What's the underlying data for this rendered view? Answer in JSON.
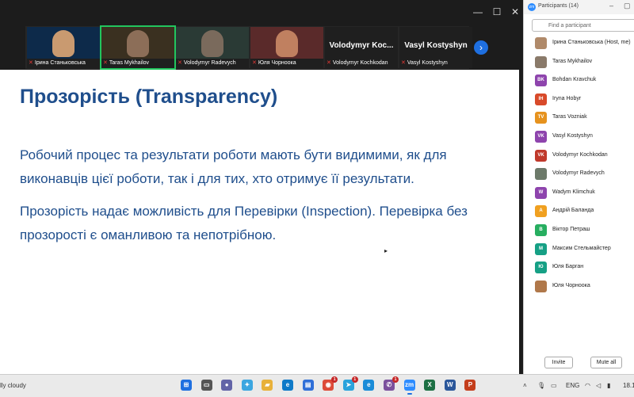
{
  "window": {
    "minimize_icon": "minimize-icon",
    "maximize_icon": "maximize-icon",
    "close_icon": "close-icon",
    "minimize_glyph": "—",
    "maximize_glyph": "☐",
    "close_glyph": "✕"
  },
  "gallery": {
    "tiles": [
      {
        "label": "Ірина Станьковська",
        "muted": true,
        "active": false,
        "video": true
      },
      {
        "label": "Taras Mykhailov",
        "muted": true,
        "active": true,
        "video": true
      },
      {
        "label": "Volodymyr Radevych",
        "muted": true,
        "active": false,
        "video": true
      },
      {
        "label": "Юля Чорноока",
        "muted": true,
        "active": false,
        "video": true
      },
      {
        "label": "Volodymyr Kochkodan",
        "muted": true,
        "active": false,
        "video": false,
        "display_name": "Volodymyr  Koc..."
      },
      {
        "label": "Vasyl Kostyshyn",
        "muted": true,
        "active": false,
        "video": false,
        "display_name": "Vasyl Kostyshyn"
      }
    ],
    "next_glyph": "›"
  },
  "slide": {
    "title": "Прозорість (Transparency)",
    "para1_line1": "Робочий процес та результати роботи мають бути видимими, як для",
    "para1_line2": "виконавців цієї роботи, так і для тих, хто отримує її результати.",
    "para2_line1": "Прозорість надає можливість для Перевірки (Inspection). Перевірка без",
    "para2_line2": "прозорості є оманливою та непотрібною."
  },
  "panel": {
    "logo_text": "zm",
    "title": "Participants (14)",
    "search_placeholder": "Find a participant",
    "participants": [
      {
        "name": "Ірина Станьковська (Host, me)",
        "initials": "",
        "color": "#b08a6a"
      },
      {
        "name": "Taras Mykhailov",
        "initials": "",
        "color": "#8a7a6a"
      },
      {
        "name": "Bohdan Kravchuk",
        "initials": "BK",
        "color": "#8e44ad"
      },
      {
        "name": "Iryna Hobyr",
        "initials": "IH",
        "color": "#d84a2a"
      },
      {
        "name": "Taras Vozniak",
        "initials": "TV",
        "color": "#e6921e"
      },
      {
        "name": "Vasyl Kostyshyn",
        "initials": "VK",
        "color": "#8e44ad"
      },
      {
        "name": "Volodymyr Kochkodan",
        "initials": "VK",
        "color": "#c0392b"
      },
      {
        "name": "Volodymyr Radevych",
        "initials": "",
        "color": "#6d7a6a"
      },
      {
        "name": "Wadym Klimchuk",
        "initials": "W",
        "color": "#8e44ad"
      },
      {
        "name": "Андрій Баланда",
        "initials": "А",
        "color": "#f0a020"
      },
      {
        "name": "Віктор Петраш",
        "initials": "В",
        "color": "#27ae60"
      },
      {
        "name": "Максим Стельмайстер",
        "initials": "М",
        "color": "#16a085"
      },
      {
        "name": "Юля Барган",
        "initials": "Ю",
        "color": "#16a085"
      },
      {
        "name": "Юля Чорноока",
        "initials": "",
        "color": "#b0784a"
      }
    ],
    "invite_label": "Invite",
    "mute_all_label": "Mute all"
  },
  "taskbar": {
    "weather": "lly cloudy",
    "language": "ENG",
    "time_partial": "18.1",
    "apps": [
      {
        "name": "start-icon",
        "color": "#1e6fe0",
        "glyph": "⊞",
        "active": false,
        "badge": ""
      },
      {
        "name": "task-view-icon",
        "color": "#555555",
        "glyph": "▭",
        "active": false,
        "badge": ""
      },
      {
        "name": "teams-chat-icon",
        "color": "#6264a7",
        "glyph": "●",
        "active": false,
        "badge": ""
      },
      {
        "name": "copilot-icon",
        "color": "#3ba6e0",
        "glyph": "✦",
        "active": false,
        "badge": ""
      },
      {
        "name": "file-explorer-icon",
        "color": "#e8b13a",
        "glyph": "▰",
        "active": false,
        "badge": ""
      },
      {
        "name": "edge-icon",
        "color": "#0f7ac8",
        "glyph": "e",
        "active": false,
        "badge": ""
      },
      {
        "name": "store-icon",
        "color": "#2f6fd8",
        "glyph": "▤",
        "active": false,
        "badge": ""
      },
      {
        "name": "chrome-icon",
        "color": "#dd4b39",
        "glyph": "◉",
        "active": false,
        "badge": "1"
      },
      {
        "name": "telegram-icon",
        "color": "#2aa3dc",
        "glyph": "➤",
        "active": false,
        "badge": "1"
      },
      {
        "name": "edge-profile-icon",
        "color": "#1a8cd8",
        "glyph": "e",
        "active": false,
        "badge": ""
      },
      {
        "name": "viber-icon",
        "color": "#7b519d",
        "glyph": "✆",
        "active": false,
        "badge": "1"
      },
      {
        "name": "zoom-icon",
        "color": "#2d8cff",
        "glyph": "zm",
        "active": true,
        "badge": ""
      },
      {
        "name": "excel-icon",
        "color": "#1d7044",
        "glyph": "X",
        "active": false,
        "badge": ""
      },
      {
        "name": "word-icon",
        "color": "#2b579a",
        "glyph": "W",
        "active": false,
        "badge": ""
      },
      {
        "name": "powerpoint-icon",
        "color": "#c43e1c",
        "glyph": "P",
        "active": false,
        "badge": ""
      }
    ]
  }
}
